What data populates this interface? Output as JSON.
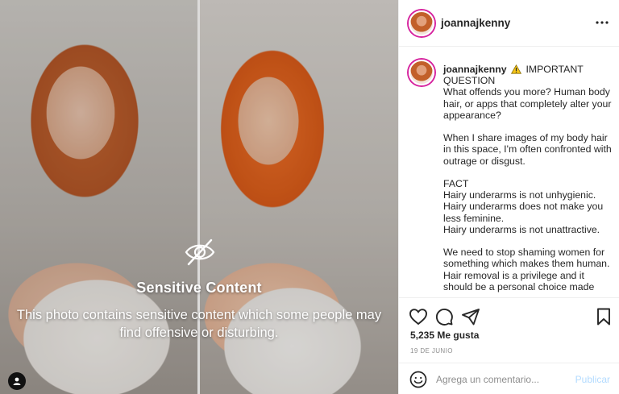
{
  "post": {
    "username": "joannajkenny",
    "more_icon": "more-horizontal-icon"
  },
  "media": {
    "overlay_icon": "eye-slash-icon",
    "overlay_title": "Sensitive Content",
    "overlay_description": "This photo contains sensitive content which some people may find offensive or disturbing."
  },
  "caption": {
    "username": "joannajkenny",
    "warning_icon": "warning-icon",
    "paragraphs": [
      [
        "IMPORTANT QUESTION",
        "What offends you more? Human body hair, or apps that completely alter your appearance?"
      ],
      [
        "When I share images of my body hair in this space, I'm often confronted with outrage or disgust."
      ],
      [
        "FACT",
        "Hairy underarms is not unhygienic.",
        "Hairy underarms does not make you less feminine.",
        "Hairy underarms is not unattractive."
      ],
      [
        "We need to stop shaming women for something which makes them human. Hair removal is a privilege and it should be a personal choice made"
      ]
    ]
  },
  "actions": {
    "likes": "5,235 Me gusta",
    "date": "19 DE JUNIO"
  },
  "comment": {
    "placeholder": "Agrega un comentario...",
    "publish_label": "Publicar"
  },
  "colors": {
    "text": "#262626",
    "muted": "#8e8e8e",
    "publish_disabled": "#b3dbff",
    "warning": "#f5c518",
    "border": "#efefef"
  }
}
